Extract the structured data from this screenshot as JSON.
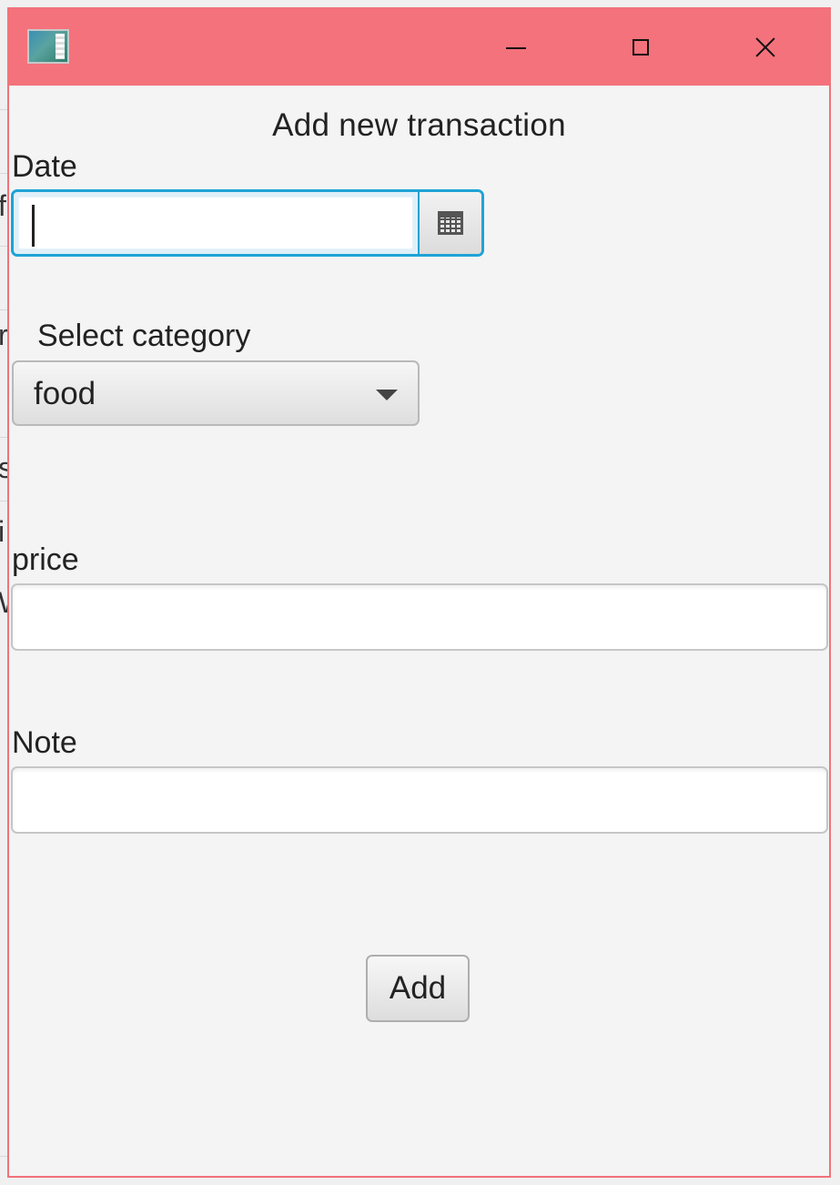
{
  "background_window": {
    "edge_glyphs": [
      "f",
      "r",
      "s",
      "i",
      "W"
    ]
  },
  "window": {
    "title": "",
    "titlebar_color": "#f4727b",
    "controls": {
      "minimize_icon": "minimize-icon",
      "maximize_icon": "maximize-icon",
      "close_icon": "close-icon"
    }
  },
  "form": {
    "heading": "Add new transaction",
    "date": {
      "label": "Date",
      "value": "",
      "calendar_icon": "calendar-icon"
    },
    "category": {
      "label": "Select category",
      "selected": "food"
    },
    "price": {
      "label": "price",
      "value": ""
    },
    "note": {
      "label": "Note",
      "value": ""
    },
    "add_button": "Add"
  },
  "colors": {
    "focus_accent": "#1fa3d6",
    "dialog_background": "#f4f4f4"
  }
}
